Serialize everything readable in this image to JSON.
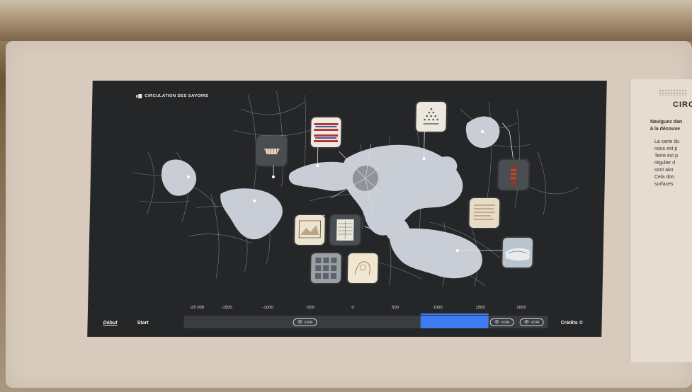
{
  "app": {
    "title": "CIRCULATION DES SAVOIRS"
  },
  "side_panel": {
    "title": "CIRC",
    "subtitle": "Naviguez dan\nà la découve",
    "text": "La carte du\nnous est p\nTerre est p\nrégulier d\nsont alor\nCela don\nsurfaces"
  },
  "timeline": {
    "ticks": [
      "-25 000",
      "-1500",
      "-1000",
      "-500",
      "0",
      "500",
      "1000",
      "1500",
      "2000"
    ],
    "voir_label": "VOIR",
    "debut_label": "Début",
    "start_label": "Start",
    "credits_label": "Crédits ©"
  },
  "colors": {
    "screen_bg": "#252628",
    "land": "#c9ced6",
    "accent": "#3d7bf0"
  }
}
